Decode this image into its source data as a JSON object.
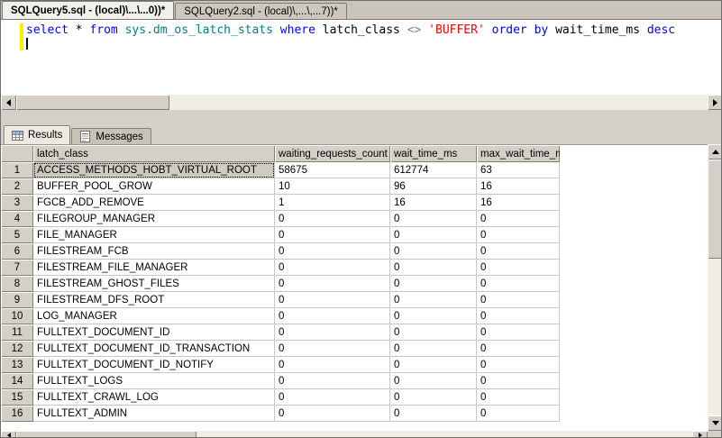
{
  "document_tabs": [
    {
      "label": "SQLQuery5.sql - (local)\\...\\...0))*",
      "active": true
    },
    {
      "label": "SQLQuery2.sql - (local)\\,...\\,...7))*",
      "active": false
    }
  ],
  "editor": {
    "query_text": "select * from sys.dm_os_latch_stats where latch_class <> 'BUFFER' order by wait_time_ms desc",
    "tokens": [
      {
        "text": "select",
        "type": "keyword"
      },
      {
        "text": " ",
        "type": "plain"
      },
      {
        "text": "*",
        "type": "plain"
      },
      {
        "text": " ",
        "type": "plain"
      },
      {
        "text": "from",
        "type": "keyword"
      },
      {
        "text": " ",
        "type": "plain"
      },
      {
        "text": "sys.dm_os_latch_stats",
        "type": "object"
      },
      {
        "text": " ",
        "type": "plain"
      },
      {
        "text": "where",
        "type": "keyword"
      },
      {
        "text": " latch_class ",
        "type": "plain"
      },
      {
        "text": "<>",
        "type": "operator"
      },
      {
        "text": " ",
        "type": "plain"
      },
      {
        "text": "'BUFFER'",
        "type": "string"
      },
      {
        "text": " ",
        "type": "plain"
      },
      {
        "text": "order",
        "type": "keyword"
      },
      {
        "text": " ",
        "type": "plain"
      },
      {
        "text": "by",
        "type": "keyword"
      },
      {
        "text": " wait_time_ms ",
        "type": "plain"
      },
      {
        "text": "desc",
        "type": "keyword"
      }
    ],
    "syntax_colors": {
      "keyword": "#0000ff",
      "object": "#008080",
      "string": "#ff0000",
      "operator": "#808080",
      "plain": "#000000"
    },
    "change_bar_color": "#f8f000"
  },
  "results_pane": {
    "tabs": [
      {
        "label": "Results",
        "icon": "results-grid-icon",
        "active": true
      },
      {
        "label": "Messages",
        "icon": "messages-icon",
        "active": false
      }
    ],
    "grid": {
      "columns": [
        "latch_class",
        "waiting_requests_count",
        "wait_time_ms",
        "max_wait_time_ms"
      ],
      "selected_cell": {
        "row_index": 0,
        "col_index": 0
      },
      "rows": [
        {
          "n": "1",
          "cells": [
            "ACCESS_METHODS_HOBT_VIRTUAL_ROOT",
            "58675",
            "612774",
            "63"
          ]
        },
        {
          "n": "2",
          "cells": [
            "BUFFER_POOL_GROW",
            "10",
            "96",
            "16"
          ]
        },
        {
          "n": "3",
          "cells": [
            "FGCB_ADD_REMOVE",
            "1",
            "16",
            "16"
          ]
        },
        {
          "n": "4",
          "cells": [
            "FILEGROUP_MANAGER",
            "0",
            "0",
            "0"
          ]
        },
        {
          "n": "5",
          "cells": [
            "FILE_MANAGER",
            "0",
            "0",
            "0"
          ]
        },
        {
          "n": "6",
          "cells": [
            "FILESTREAM_FCB",
            "0",
            "0",
            "0"
          ]
        },
        {
          "n": "7",
          "cells": [
            "FILESTREAM_FILE_MANAGER",
            "0",
            "0",
            "0"
          ]
        },
        {
          "n": "8",
          "cells": [
            "FILESTREAM_GHOST_FILES",
            "0",
            "0",
            "0"
          ]
        },
        {
          "n": "9",
          "cells": [
            "FILESTREAM_DFS_ROOT",
            "0",
            "0",
            "0"
          ]
        },
        {
          "n": "10",
          "cells": [
            "LOG_MANAGER",
            "0",
            "0",
            "0"
          ]
        },
        {
          "n": "11",
          "cells": [
            "FULLTEXT_DOCUMENT_ID",
            "0",
            "0",
            "0"
          ]
        },
        {
          "n": "12",
          "cells": [
            "FULLTEXT_DOCUMENT_ID_TRANSACTION",
            "0",
            "0",
            "0"
          ]
        },
        {
          "n": "13",
          "cells": [
            "FULLTEXT_DOCUMENT_ID_NOTIFY",
            "0",
            "0",
            "0"
          ]
        },
        {
          "n": "14",
          "cells": [
            "FULLTEXT_LOGS",
            "0",
            "0",
            "0"
          ]
        },
        {
          "n": "15",
          "cells": [
            "FULLTEXT_CRAWL_LOG",
            "0",
            "0",
            "0"
          ]
        },
        {
          "n": "16",
          "cells": [
            "FULLTEXT_ADMIN",
            "0",
            "0",
            "0"
          ]
        }
      ]
    }
  }
}
